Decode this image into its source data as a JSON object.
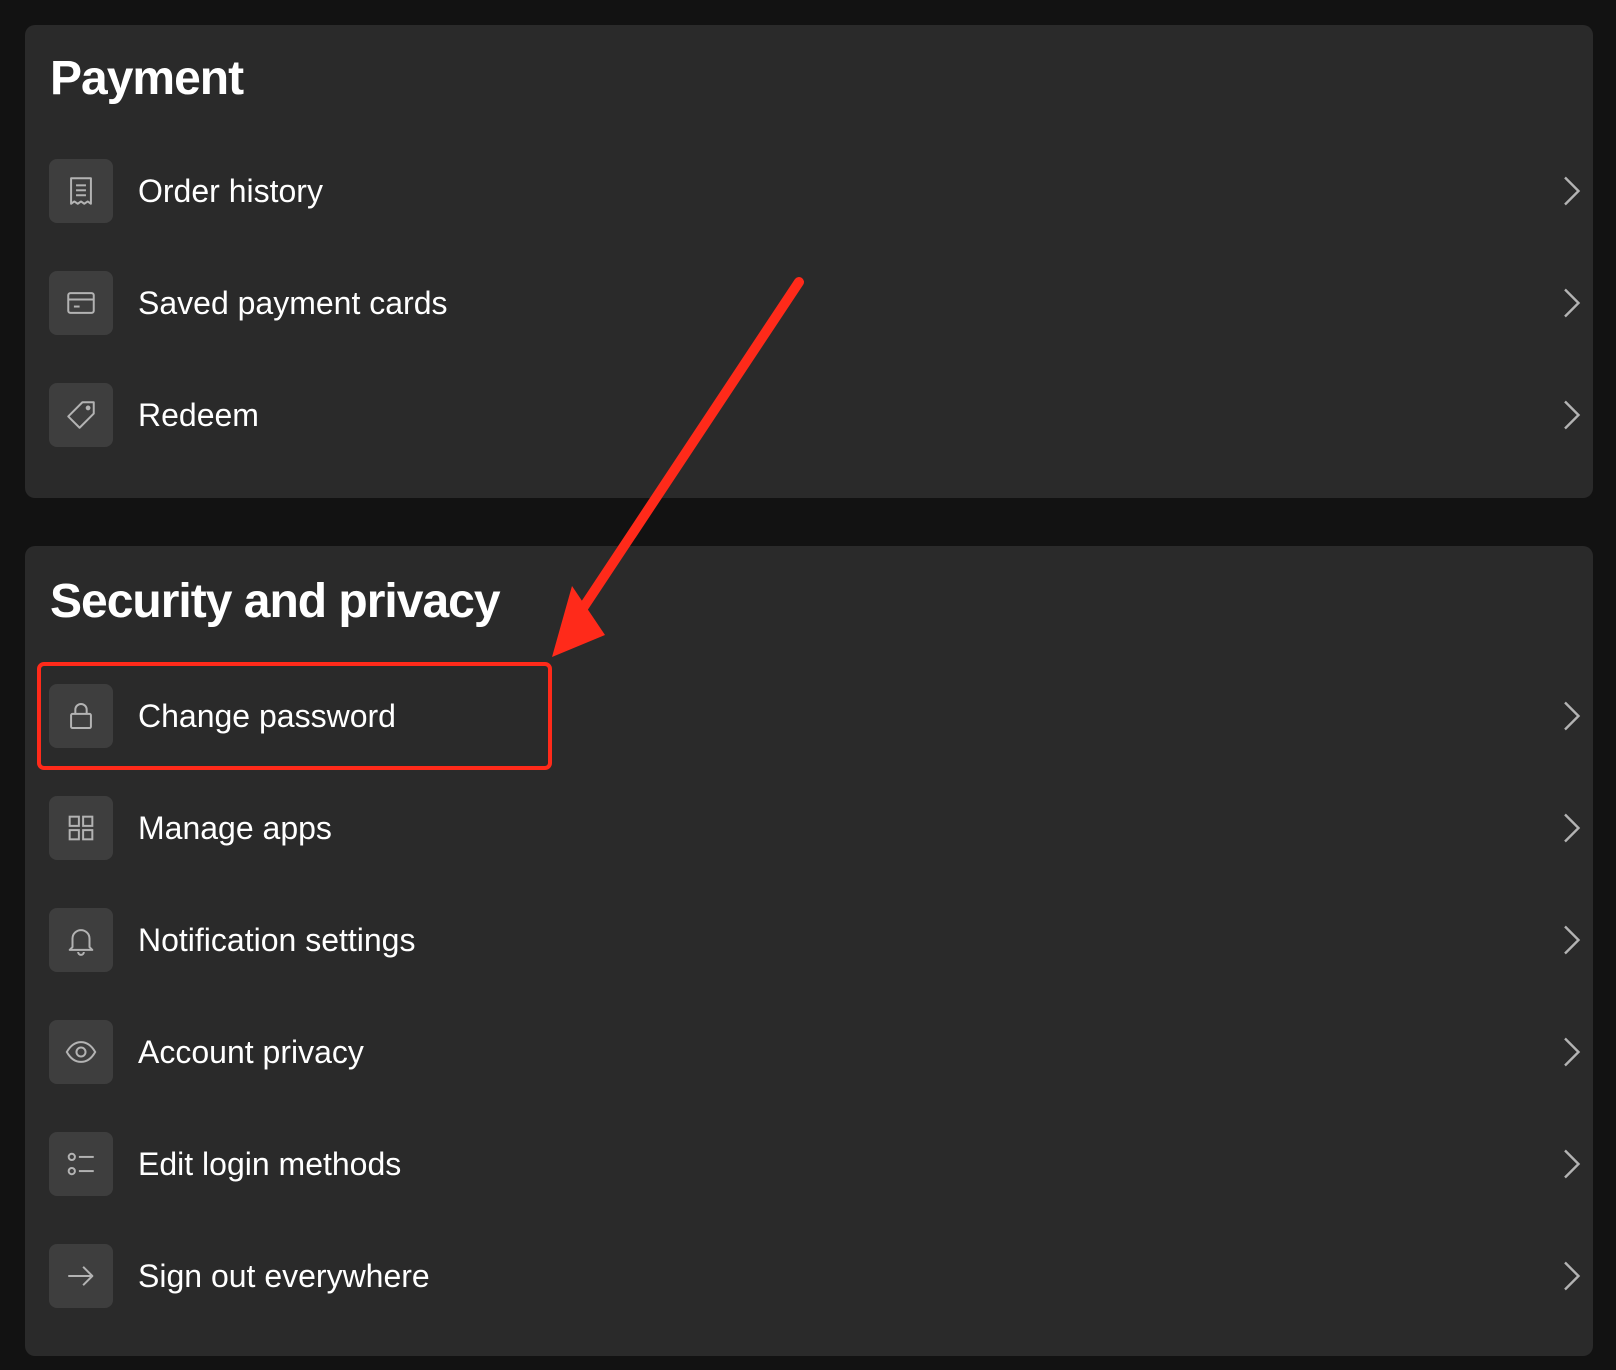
{
  "payment": {
    "title": "Payment",
    "items": [
      {
        "label": "Order history",
        "icon": "receipt-icon"
      },
      {
        "label": "Saved payment cards",
        "icon": "credit-card-icon"
      },
      {
        "label": "Redeem",
        "icon": "tag-icon"
      }
    ]
  },
  "security": {
    "title": "Security and privacy",
    "items": [
      {
        "label": "Change password",
        "icon": "lock-icon"
      },
      {
        "label": "Manage apps",
        "icon": "grid-icon"
      },
      {
        "label": "Notification settings",
        "icon": "bell-icon"
      },
      {
        "label": "Account privacy",
        "icon": "eye-icon"
      },
      {
        "label": "Edit login methods",
        "icon": "list-icon"
      },
      {
        "label": "Sign out everywhere",
        "icon": "arrow-right-icon"
      }
    ]
  },
  "annotation": {
    "highlight_color": "#ff2a1a",
    "highlighted_item": "Change password"
  },
  "colors": {
    "page_background": "#121212",
    "card_background": "#2a2a2a",
    "icon_tile": "#3e3e3e",
    "text": "#ffffff",
    "icon_stroke": "#b3b3b3"
  }
}
